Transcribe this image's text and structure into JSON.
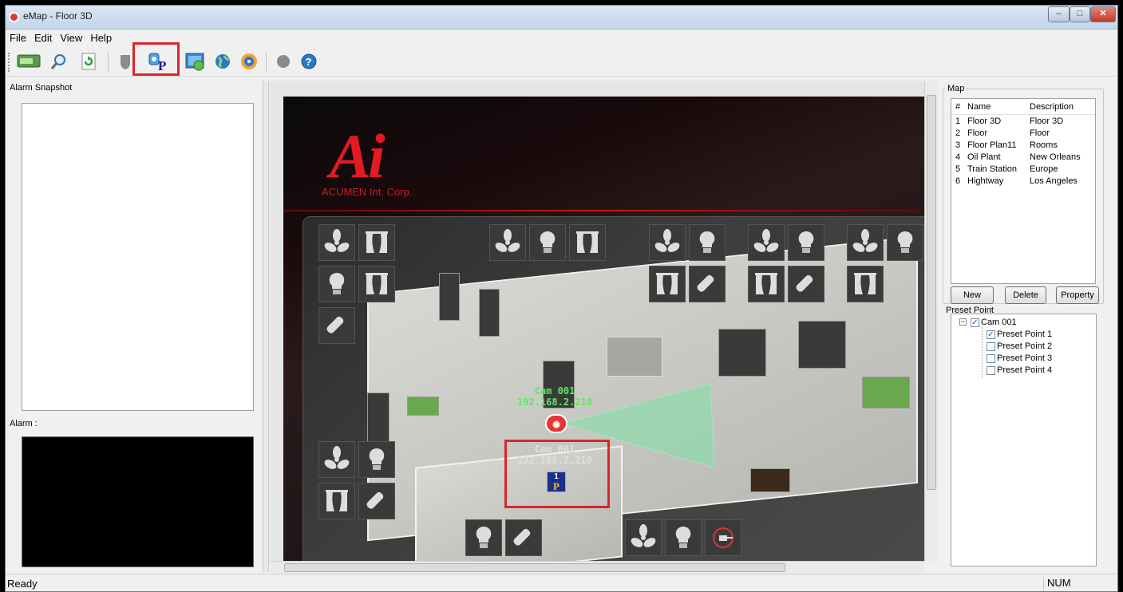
{
  "window": {
    "title": "eMap - Floor 3D",
    "minimize": "‒",
    "maximize": "□",
    "close": "✕"
  },
  "menu": [
    "File",
    "Edit",
    "View",
    "Help"
  ],
  "toolbar": {
    "buttons": [
      "monitor-icon",
      "search-icon",
      "refresh-icon",
      "shield-icon",
      "preset-point-icon",
      "map-edit-icon",
      "globe-icon",
      "globe-gear-icon",
      "record-icon",
      "help-icon"
    ],
    "highlight_color": "#d9262a"
  },
  "left": {
    "alarm_snapshot_label": "Alarm Snapshot",
    "alarm_label": "Alarm :"
  },
  "map": {
    "logo_letters": "Ai",
    "logo_text": "ACUMEN Int. Corp.",
    "camera_top": {
      "name": "Cam 001",
      "ip": "192.168.2.210",
      "color": "#5fe85f"
    },
    "camera_bottom": {
      "name": "Cam 001",
      "ip": "192.168.2.210",
      "color": "#e0e0e0"
    },
    "preset_number": "1",
    "preset_letter": "P"
  },
  "right": {
    "map_group_label": "Map",
    "columns": [
      "#",
      "Name",
      "Description"
    ],
    "rows": [
      [
        "1",
        "Floor 3D",
        "Floor 3D"
      ],
      [
        "2",
        "Floor",
        "Floor"
      ],
      [
        "3",
        "Floor Plan11",
        "Rooms"
      ],
      [
        "4",
        "Oil Plant",
        "New Orleans"
      ],
      [
        "5",
        "Train Station",
        "Europe"
      ],
      [
        "6",
        "Hightway",
        "Los Angeles"
      ]
    ],
    "buttons": {
      "new": "New",
      "delete": "Delete",
      "property": "Property"
    },
    "preset_group_label": "Preset Point",
    "tree": {
      "root": {
        "label": "Cam 001",
        "checked": true
      },
      "children": [
        {
          "label": "Preset Point 1",
          "checked": true
        },
        {
          "label": "Preset Point 2",
          "checked": false
        },
        {
          "label": "Preset Point 3",
          "checked": false
        },
        {
          "label": "Preset Point 4",
          "checked": false
        }
      ]
    }
  },
  "status": {
    "text": "Ready",
    "num": "NUM"
  }
}
